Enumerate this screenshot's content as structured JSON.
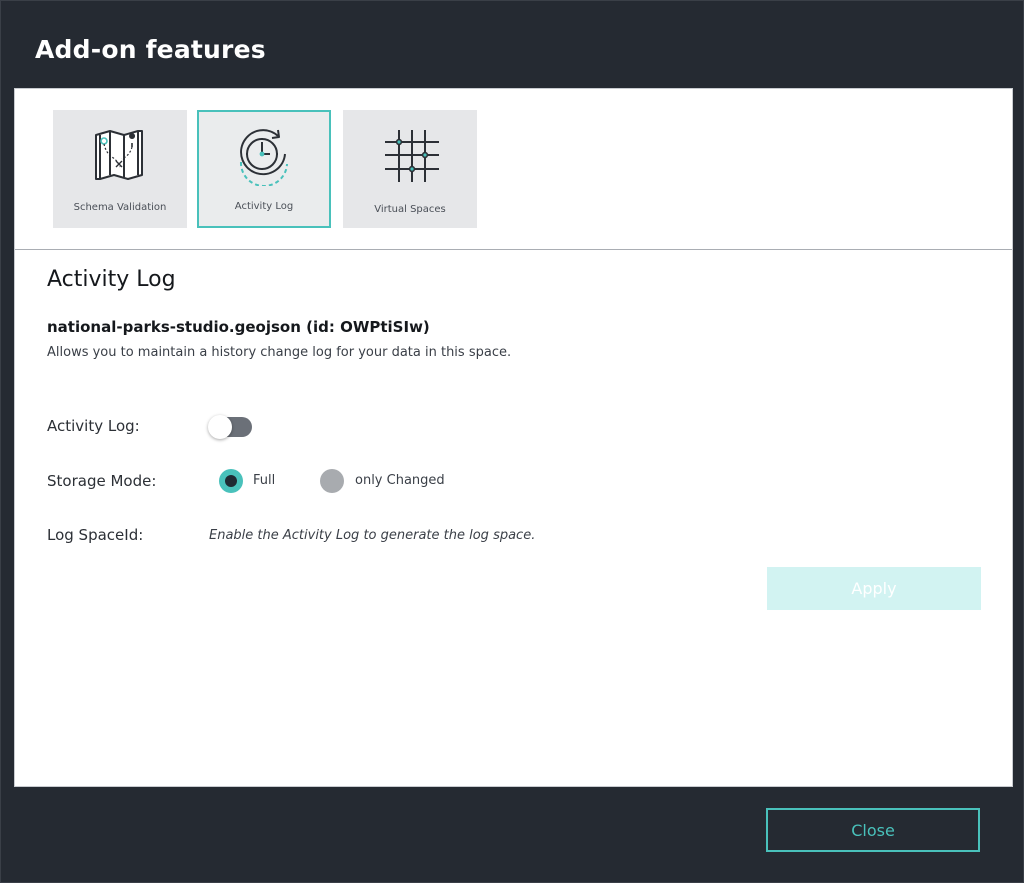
{
  "modal": {
    "title": "Add-on features",
    "close_label": "Close"
  },
  "tiles": [
    {
      "label": "Schema Validation",
      "icon": "map-icon",
      "active": false
    },
    {
      "label": "Activity Log",
      "icon": "clock-refresh-icon",
      "active": true
    },
    {
      "label": "Virtual Spaces",
      "icon": "grid-icon",
      "active": false
    }
  ],
  "panel": {
    "title": "Activity Log",
    "space_name": "national-parks-studio.geojson (id: OWPtiSIw)",
    "description": "Allows you to maintain a history change log for your data in this space.",
    "activity_log_label": "Activity Log:",
    "activity_log_enabled": false,
    "storage_mode_label": "Storage Mode:",
    "storage_options": [
      {
        "label": "Full",
        "selected": true
      },
      {
        "label": "only Changed",
        "selected": false
      }
    ],
    "log_spaceid_label": "Log SpaceId:",
    "log_spaceid_hint": "Enable the Activity Log to generate the log space.",
    "apply_label": "Apply"
  },
  "colors": {
    "accent": "#49c1bb",
    "modal_bg": "#252a32",
    "apply_disabled_bg": "#d2f3f2"
  }
}
